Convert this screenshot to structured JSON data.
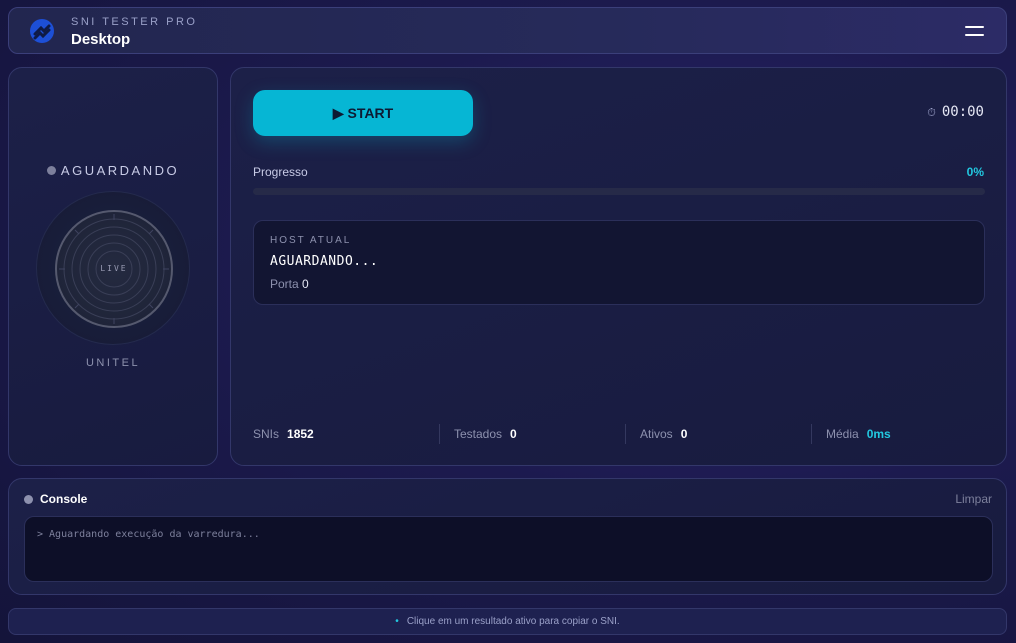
{
  "header": {
    "app_subtitle": "SNI TESTER PRO",
    "app_title": "Desktop",
    "logo_icon": "logo-icon",
    "menu_icon": "hamburger-menu-icon"
  },
  "status_panel": {
    "status": "AGUARDANDO",
    "dial_label": "LIVE",
    "operator": "UNITEL"
  },
  "controls": {
    "start_label": "▶ START",
    "timer": "00:00",
    "timer_icon": "⏱"
  },
  "progress": {
    "label": "Progresso",
    "percent_text": "0%",
    "value": 0
  },
  "host": {
    "label": "HOST ATUAL",
    "value": "AGUARDANDO...",
    "port_label": "Porta",
    "port_value": "0"
  },
  "stats": [
    {
      "label": "SNIs",
      "value": "1852"
    },
    {
      "label": "Testados",
      "value": "0"
    },
    {
      "label": "Ativos",
      "value": "0"
    },
    {
      "label": "Média",
      "value": "0ms"
    }
  ],
  "console": {
    "title": "Console",
    "clear_label": "Limpar",
    "lines": [
      "> Aguardando execução da varredura..."
    ]
  },
  "footer": {
    "bullet": "•",
    "hint": "Clique em um resultado ativo para copiar o SNI."
  },
  "colors": {
    "accent": "#06b6d4",
    "background": "#1c1a4e",
    "card": "#1b1f46"
  }
}
